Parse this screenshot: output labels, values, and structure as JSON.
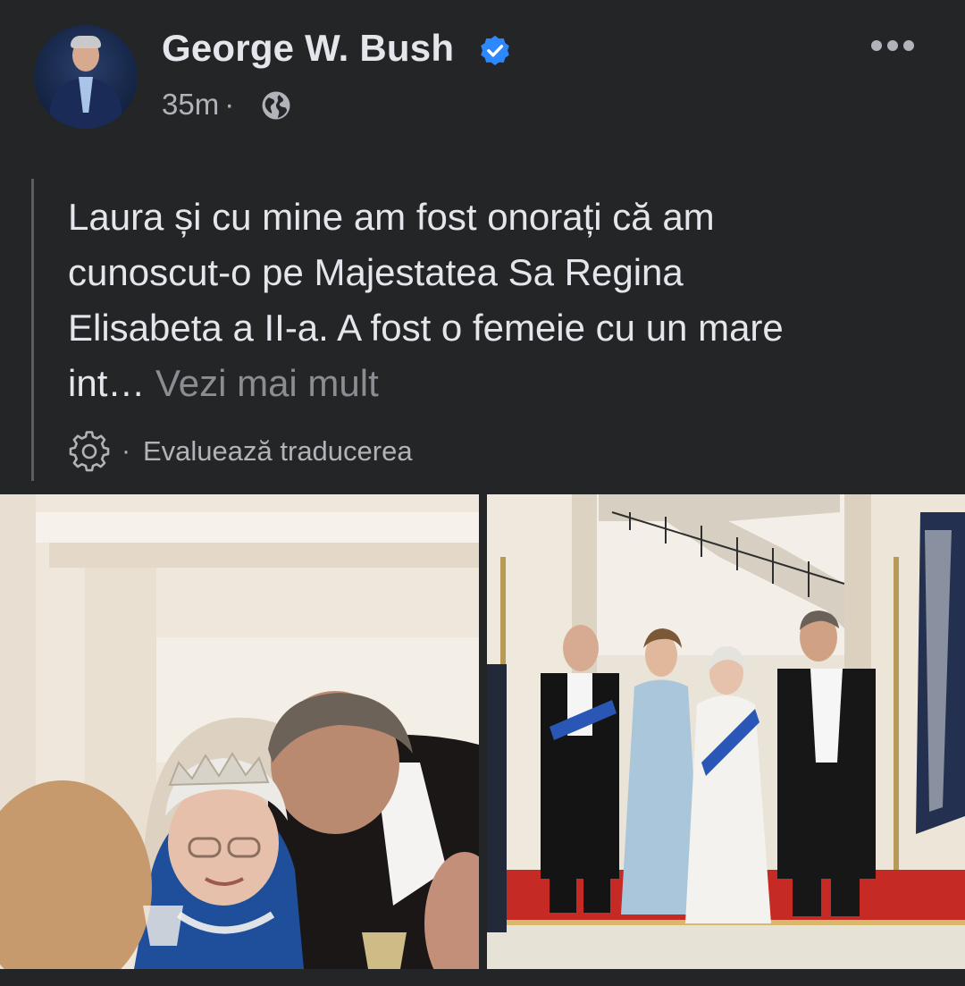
{
  "post": {
    "author": {
      "name": "George W. Bush",
      "verified": true
    },
    "timestamp": "35m",
    "audience_separator": "·",
    "text_lines": [
      "Laura și cu mine am fost onorați că am",
      "cunoscut-o pe Majestatea Sa Regina",
      "Elisabeta a II-a. A fost o femeie cu un mare",
      "int…"
    ],
    "see_more_label": "Vezi mai mult",
    "translation": {
      "separator": "·",
      "rate_label": "Evaluează traducerea"
    },
    "photos": [
      {
        "icon": "photo-dinner"
      },
      {
        "icon": "photo-group-portrait"
      }
    ]
  },
  "icons": {
    "verified": "verified-badge-icon",
    "audience": "globe-icon",
    "more": "more-options-icon",
    "translation": "gear-icon"
  },
  "colors": {
    "background": "#242526",
    "primary_text": "#e4e6eb",
    "secondary_text": "#b0b3b8",
    "verified_blue": "#2d88ff"
  }
}
